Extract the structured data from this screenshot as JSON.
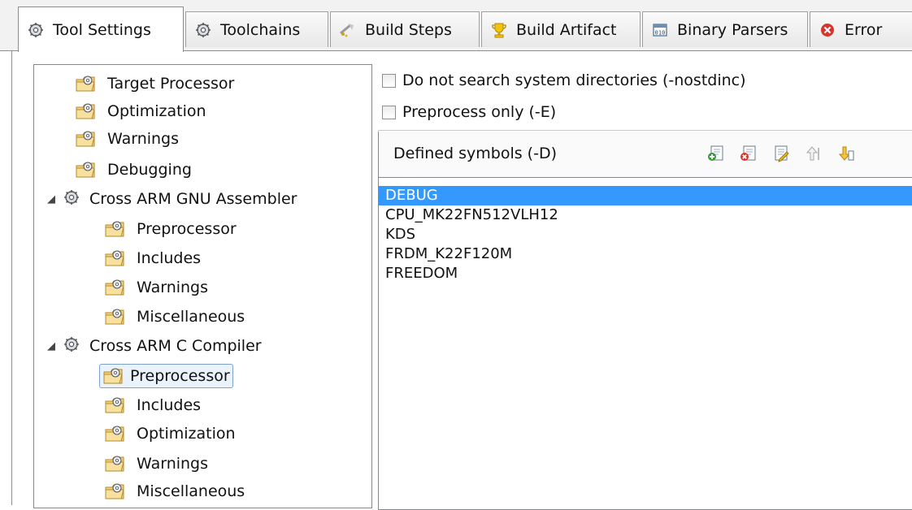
{
  "tabs": [
    {
      "label": "Tool Settings",
      "icon": "gear-icon",
      "active": true
    },
    {
      "label": "Toolchains",
      "icon": "gear-icon",
      "active": false
    },
    {
      "label": "Build Steps",
      "icon": "build-steps-icon",
      "active": false
    },
    {
      "label": "Build Artifact",
      "icon": "trophy-icon",
      "active": false
    },
    {
      "label": "Binary Parsers",
      "icon": "binary-icon",
      "active": false
    },
    {
      "label": "Error",
      "icon": "error-icon",
      "active": false
    }
  ],
  "tree": [
    {
      "label": "Target Processor",
      "level": 1,
      "type": "folder"
    },
    {
      "label": "Optimization",
      "level": 1,
      "type": "folder"
    },
    {
      "label": "Warnings",
      "level": 1,
      "type": "folder"
    },
    {
      "label": "Debugging",
      "level": 1,
      "type": "folder"
    },
    {
      "label": "Cross ARM GNU Assembler",
      "level": 0,
      "type": "tool",
      "expanded": true
    },
    {
      "label": "Preprocessor",
      "level": 2,
      "type": "folder"
    },
    {
      "label": "Includes",
      "level": 2,
      "type": "folder"
    },
    {
      "label": "Warnings",
      "level": 2,
      "type": "folder"
    },
    {
      "label": "Miscellaneous",
      "level": 2,
      "type": "folder"
    },
    {
      "label": "Cross ARM C Compiler",
      "level": 0,
      "type": "tool",
      "expanded": true
    },
    {
      "label": "Preprocessor",
      "level": 2,
      "type": "folder",
      "selected": true
    },
    {
      "label": "Includes",
      "level": 2,
      "type": "folder"
    },
    {
      "label": "Optimization",
      "level": 2,
      "type": "folder"
    },
    {
      "label": "Warnings",
      "level": 2,
      "type": "folder"
    },
    {
      "label": "Miscellaneous",
      "level": 2,
      "type": "folder"
    }
  ],
  "options": [
    {
      "label": "Do not search system directories (-nostdinc)",
      "checked": false
    },
    {
      "label": "Preprocess only (-E)",
      "checked": false
    }
  ],
  "symbols": {
    "title": "Defined symbols (-D)",
    "toolbar": [
      "add-icon",
      "delete-icon",
      "edit-icon",
      "move-up-icon",
      "move-down-icon"
    ],
    "items": [
      "DEBUG",
      "CPU_MK22FN512VLH12",
      "KDS",
      "FRDM_K22F120M",
      "FREEDOM"
    ],
    "selected_index": 0
  },
  "colors": {
    "selection": "#3399ff",
    "tree_selection_border": "#7da2ce"
  }
}
